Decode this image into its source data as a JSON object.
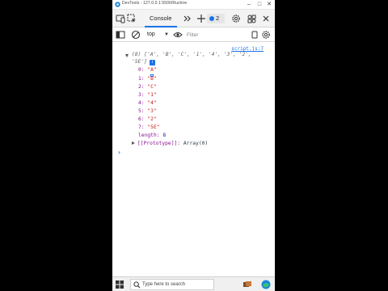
{
  "window": {
    "title": "DevTools - 127.0.0.1:5500/Ruchire"
  },
  "tabs": {
    "console_label": "Console",
    "issues_count": "2"
  },
  "toolbar": {
    "context": "top",
    "filter_placeholder": "Filter"
  },
  "console": {
    "source_link": "script.js:7",
    "summary_line1": "(8) ['A', 'B', 'C', '1', '4', '3', '2',",
    "summary_line2": "'5E']",
    "info_icon": "i",
    "entries": [
      {
        "key": "0:",
        "value": "\"A\""
      },
      {
        "key": "1:",
        "value": "\"B\""
      },
      {
        "key": "2:",
        "value": "\"C\""
      },
      {
        "key": "3:",
        "value": "\"1\""
      },
      {
        "key": "4:",
        "value": "\"4\""
      },
      {
        "key": "5:",
        "value": "\"3\""
      },
      {
        "key": "6:",
        "value": "\"2\""
      },
      {
        "key": "7:",
        "value": "\"5E\""
      }
    ],
    "length_key": "length:",
    "length_value": "8",
    "prototype_key": "[[Prototype]]:",
    "prototype_value": "Array(0)",
    "prompt_glyph": "›"
  },
  "taskbar": {
    "search_label": "Type here to search"
  },
  "colors": {
    "accent": "#1a73e8",
    "string_value": "#c41a16",
    "property_key": "#881391",
    "number_value": "#1a1aa6"
  },
  "icons": {
    "app": "edge-devtools-icon",
    "device_toolbar": "device-toolbar-icon",
    "inspect": "inspect-element-icon",
    "welcome": "welcome-home-icon",
    "more_tabs": "more-tabs-icon",
    "add_tab": "add-tab-icon",
    "issues": "issues-icon",
    "settings": "gear-icon",
    "customize": "customize-icon",
    "sidebar": "sidebar-toggle-icon",
    "clear": "clear-console-icon",
    "eye": "live-expression-icon",
    "windows_start": "windows-start-icon",
    "search": "search-icon",
    "edge": "edge-browser-icon"
  }
}
